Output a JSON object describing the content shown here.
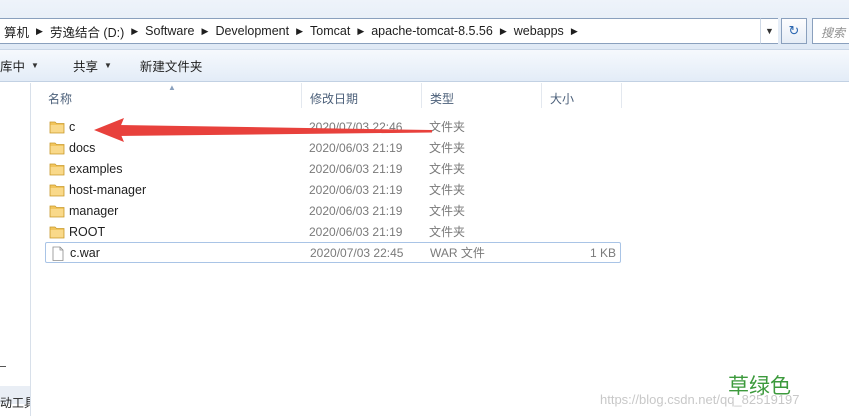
{
  "address_bar": {
    "crumbs": [
      "算机",
      "劳逸结合 (D:)",
      "Software",
      "Development",
      "Tomcat",
      "apache-tomcat-8.5.56",
      "webapps"
    ],
    "search_placeholder": "搜索"
  },
  "toolbar": {
    "organize_label": "库中",
    "share_label": "共享",
    "new_folder_label": "新建文件夹"
  },
  "nav_pane": {
    "bottom_label": "动工具"
  },
  "columns": {
    "name": "名称",
    "date": "修改日期",
    "type": "类型",
    "size": "大小"
  },
  "files": [
    {
      "name": "c",
      "date": "2020/07/03 22:46",
      "type": "文件夹",
      "size": "",
      "icon": "folder-icon"
    },
    {
      "name": "docs",
      "date": "2020/06/03 21:19",
      "type": "文件夹",
      "size": "",
      "icon": "folder-icon"
    },
    {
      "name": "examples",
      "date": "2020/06/03 21:19",
      "type": "文件夹",
      "size": "",
      "icon": "folder-icon"
    },
    {
      "name": "host-manager",
      "date": "2020/06/03 21:19",
      "type": "文件夹",
      "size": "",
      "icon": "folder-icon"
    },
    {
      "name": "manager",
      "date": "2020/06/03 21:19",
      "type": "文件夹",
      "size": "",
      "icon": "folder-icon"
    },
    {
      "name": "ROOT",
      "date": "2020/06/03 21:19",
      "type": "文件夹",
      "size": "",
      "icon": "folder-icon"
    },
    {
      "name": "c.war",
      "date": "2020/07/03 22:45",
      "type": "WAR 文件",
      "size": "1 KB",
      "icon": "file-icon"
    }
  ],
  "watermark": {
    "caption": "草绿色",
    "url": "https://blog.csdn.net/qq_82519197"
  },
  "colors": {
    "arrow": "#e8413c",
    "folder": "#f2c55c",
    "caption": "#3c9a3c"
  }
}
